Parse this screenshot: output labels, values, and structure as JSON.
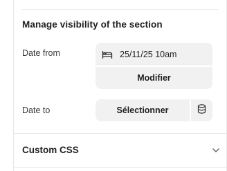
{
  "visibility": {
    "title": "Manage visibility of the section",
    "date_from": {
      "label": "Date from",
      "value": "25/11/25 10am",
      "icon": "calendar-bed-icon",
      "modify_label": "Modifier"
    },
    "date_to": {
      "label": "Date to",
      "select_label": "Sélectionner",
      "icon": "database-icon"
    }
  },
  "custom_css": {
    "title": "Custom CSS",
    "icon": "chevron-down-icon"
  },
  "colors": {
    "button_bg": "#f1f1f1",
    "divider": "#e6e6e6",
    "text": "#1f1f1f"
  }
}
